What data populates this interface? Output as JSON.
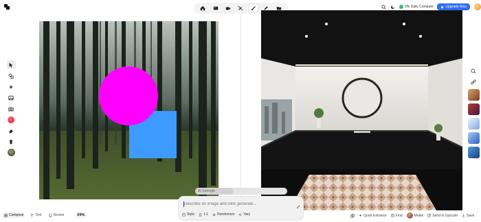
{
  "toolbar": {
    "items": [
      {
        "name": "home-icon"
      },
      {
        "name": "image-icon"
      },
      {
        "name": "video-icon"
      },
      {
        "name": "no-pen-icon"
      },
      {
        "name": "brush-icon",
        "active": true
      },
      {
        "name": "edit-icon"
      },
      {
        "name": "folder-icon"
      }
    ]
  },
  "header": {
    "compute_label": "0% Daily Compute",
    "upgrade_label": "Upgrade Now"
  },
  "canvas": {
    "shapes": [
      {
        "kind": "circle",
        "color": "#ff00ff"
      },
      {
        "kind": "square",
        "color": "#3d9bff"
      }
    ]
  },
  "prompt": {
    "strength_label": "AI Strength",
    "strength_value": 0.42,
    "placeholder": "Describe an image and click generate...",
    "style_label": "Style",
    "ratio_label": "1:1",
    "randomize_label": "Randomize",
    "vary_label": "Vary"
  },
  "bottom_left": {
    "compose_label": "Compose",
    "text_label": "Text",
    "screen_label": "Screen",
    "zoom_label": "69%"
  },
  "bottom_right": {
    "quick_enhance_label": "Quick Enhance",
    "find_label": "Find",
    "model_label": "Model",
    "send_upscale_label": "Send to Upscale",
    "save_label": "Save"
  },
  "colors": {
    "accent": "#2d6cf6",
    "status_green": "#27c26c"
  }
}
